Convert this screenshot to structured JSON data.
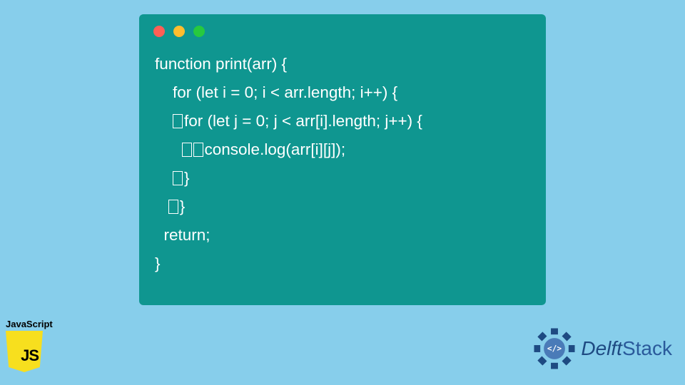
{
  "code": {
    "line1": "function print(arr) {",
    "line2": "    for (let i = 0; i < arr.length; i++) {",
    "line3_a": "    ",
    "line3_b": "for (let j = 0; j < arr[i].length; j++) {",
    "line4_a": "      ",
    "line4_b": "console.log(arr[i][j]);",
    "line5_a": "    ",
    "line5_b": "}",
    "line6_a": "   ",
    "line6_b": "}",
    "line7": "  return;",
    "line8": "}"
  },
  "window": {
    "dots": {
      "red": "#ff5f56",
      "yellow": "#ffbd2e",
      "green": "#27c93f"
    }
  },
  "badge": {
    "label": "JavaScript",
    "shieldText": "JS"
  },
  "brand": {
    "first": "Delft",
    "second": "Stack"
  }
}
